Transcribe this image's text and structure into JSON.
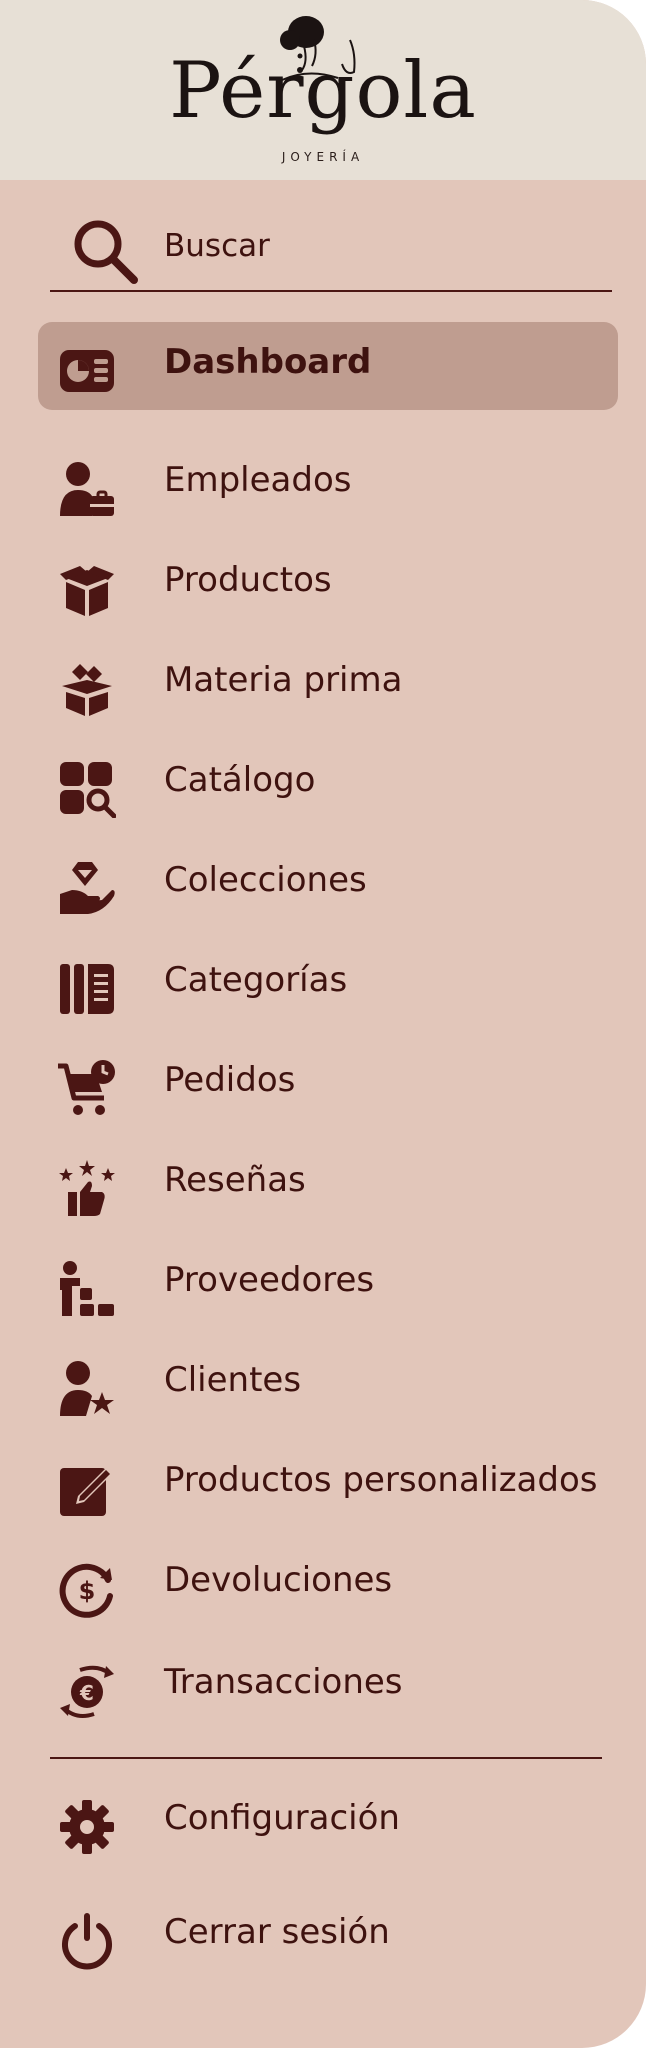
{
  "brand": {
    "name": "Pérgola",
    "subtitle": "JOYERÍA"
  },
  "search": {
    "label": "Buscar",
    "icon": "search-icon"
  },
  "nav": {
    "items": [
      {
        "label": "Dashboard",
        "icon": "dashboard-icon",
        "active": true
      },
      {
        "label": "Empleados",
        "icon": "employee-icon"
      },
      {
        "label": "Productos",
        "icon": "box-icon"
      },
      {
        "label": "Materia prima",
        "icon": "raw-material-icon"
      },
      {
        "label": "Catálogo",
        "icon": "catalog-icon"
      },
      {
        "label": "Colecciones",
        "icon": "collection-icon"
      },
      {
        "label": "Categorías",
        "icon": "categories-icon"
      },
      {
        "label": "Pedidos",
        "icon": "cart-icon"
      },
      {
        "label": "Reseñas",
        "icon": "reviews-icon"
      },
      {
        "label": "Proveedores",
        "icon": "suppliers-icon"
      },
      {
        "label": "Clientes",
        "icon": "clients-icon"
      },
      {
        "label": "Productos personalizados",
        "icon": "custom-products-icon"
      },
      {
        "label": "Devoluciones",
        "icon": "returns-icon"
      },
      {
        "label": "Transacciones",
        "icon": "transactions-icon"
      }
    ]
  },
  "footer": {
    "settings_label": "Configuración",
    "logout_label": "Cerrar sesión"
  },
  "colors": {
    "sidebar_bg": "#e2c6ba",
    "header_bg": "#e7e0d6",
    "active_bg": "#bf9d90",
    "text": "#3e120f",
    "icon": "#4b1614"
  }
}
